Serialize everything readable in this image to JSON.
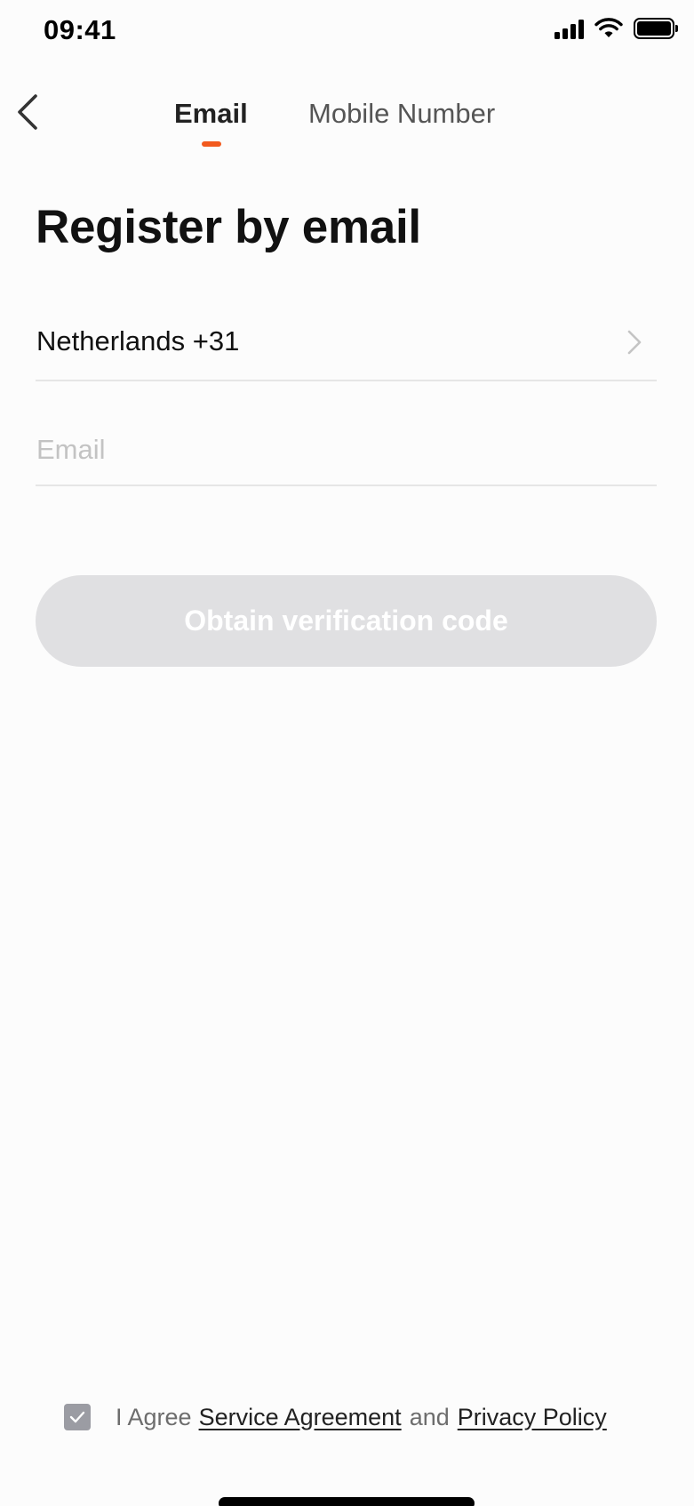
{
  "status_bar": {
    "time": "09:41",
    "icons": [
      "cellular-signal-icon",
      "wifi-icon",
      "battery-icon"
    ]
  },
  "nav": {
    "back_icon": "chevron-left-icon",
    "tabs": [
      {
        "label": "Email",
        "selected": true
      },
      {
        "label": "Mobile Number",
        "selected": false
      }
    ],
    "indicator_color": "#f25a1e"
  },
  "title": "Register by email",
  "form": {
    "country": "Netherlands +31",
    "country_icon": "chevron-right-icon",
    "email_value": "",
    "email_placeholder": "Email",
    "submit_label": "Obtain verification code",
    "submit_enabled": false
  },
  "agreement": {
    "checked": true,
    "prefix": "I Agree",
    "service_link": "Service Agreement",
    "conjunction": "and",
    "privacy_link": "Privacy Policy"
  }
}
